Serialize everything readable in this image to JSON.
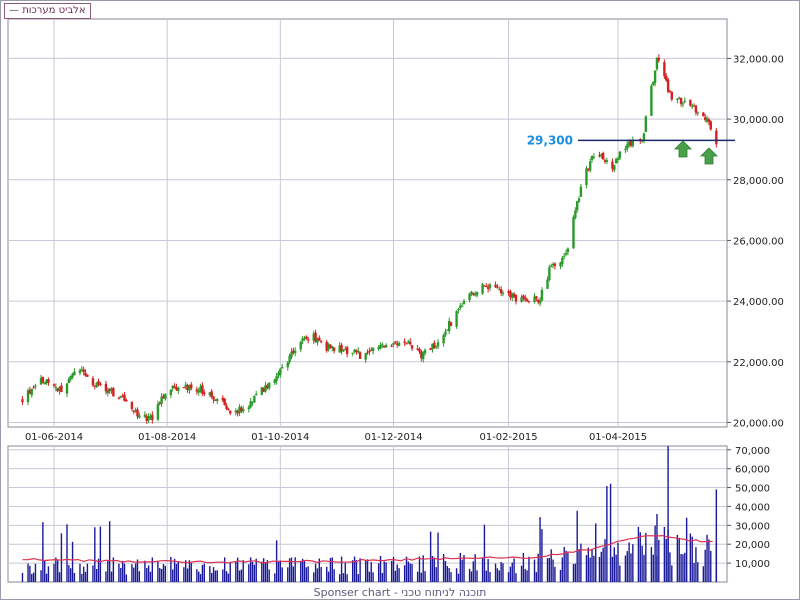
{
  "legend": {
    "dash": "—",
    "name": "אלביט מערכות"
  },
  "footer": {
    "text": "Sponser chart - תוכנה לניתוח טכני"
  },
  "colors": {
    "up": "#2a9a2a",
    "down": "#d42020",
    "volume": "#1a1a99",
    "volume_ma": "#e03050",
    "support": "#1a2a66",
    "support_label": "#1a8fe0",
    "grid": "#c8c8d8",
    "arrow": "#4aa04a",
    "watermark": "#e4e0ef"
  },
  "annotations": {
    "support_label": "29,300",
    "arrows": 2,
    "watermark_icon": "trend-arrow-circle-icon"
  },
  "chart_data": [
    {
      "type": "candlestick",
      "title": "",
      "x_ticks": [
        "01-06-2014",
        "01-08-2014",
        "01-10-2014",
        "01-12-2014",
        "01-02-2015",
        "01-04-2015"
      ],
      "y_ticks": [
        "20,000.00",
        "22,000.00",
        "24,000.00",
        "26,000.00",
        "28,000.00",
        "30,000.00",
        "32,000.00"
      ],
      "ylim": [
        19850,
        33300
      ],
      "grid": true,
      "horizontal_line": 29300,
      "close_path": [
        [
          "2014-05-15",
          20800
        ],
        [
          "2014-05-25",
          21400
        ],
        [
          "2014-06-06",
          21050
        ],
        [
          "2014-06-14",
          21900
        ],
        [
          "2014-06-22",
          21300
        ],
        [
          "2014-07-06",
          20900
        ],
        [
          "2014-07-16",
          20300
        ],
        [
          "2014-07-24",
          20100
        ],
        [
          "2014-08-01",
          21100
        ],
        [
          "2014-08-15",
          21200
        ],
        [
          "2014-08-28",
          20800
        ],
        [
          "2014-09-05",
          20300
        ],
        [
          "2014-09-14",
          20600
        ],
        [
          "2014-09-28",
          21500
        ],
        [
          "2014-10-10",
          22500
        ],
        [
          "2014-10-18",
          22900
        ],
        [
          "2014-10-25",
          22500
        ],
        [
          "2014-11-04",
          22400
        ],
        [
          "2014-11-14",
          22200
        ],
        [
          "2014-11-22",
          22400
        ],
        [
          "2014-12-06",
          22700
        ],
        [
          "2014-12-16",
          22200
        ],
        [
          "2014-12-24",
          22600
        ],
        [
          "2015-01-03",
          23500
        ],
        [
          "2015-01-10",
          24200
        ],
        [
          "2015-01-20",
          24500
        ],
        [
          "2015-02-01",
          24200
        ],
        [
          "2015-02-08",
          24000
        ],
        [
          "2015-02-18",
          24100
        ],
        [
          "2015-02-24",
          25200
        ],
        [
          "2015-03-04",
          25500
        ],
        [
          "2015-03-12",
          27800
        ],
        [
          "2015-03-20",
          29000
        ],
        [
          "2015-03-28",
          28400
        ],
        [
          "2015-04-06",
          29200
        ],
        [
          "2015-04-14",
          29300
        ],
        [
          "2015-04-22",
          32000
        ],
        [
          "2015-04-30",
          30700
        ],
        [
          "2015-05-10",
          30400
        ],
        [
          "2015-05-18",
          30100
        ],
        [
          "2015-05-24",
          29300
        ]
      ]
    },
    {
      "type": "bar",
      "title": "",
      "y_ticks": [
        "10,000",
        "20,000",
        "30,000",
        "40,000",
        "50,000",
        "60,000",
        "70,000"
      ],
      "ylim": [
        0,
        72000
      ],
      "series": [
        {
          "values": "daily volume bars"
        }
      ],
      "moving_average_path": [
        [
          "2014-05-15",
          12000
        ],
        [
          "2014-07-01",
          11000
        ],
        [
          "2014-09-01",
          10500
        ],
        [
          "2014-11-01",
          11000
        ],
        [
          "2015-01-01",
          12500
        ],
        [
          "2015-02-15",
          13000
        ],
        [
          "2015-03-15",
          17000
        ],
        [
          "2015-04-01",
          21000
        ],
        [
          "2015-04-20",
          25000
        ],
        [
          "2015-05-10",
          22000
        ],
        [
          "2015-05-24",
          21000
        ]
      ],
      "highlight_volumes": [
        [
          "2015-03-20",
          31000
        ],
        [
          "2015-03-28",
          52000
        ],
        [
          "2015-04-22",
          36000
        ],
        [
          "2015-04-28",
          72000
        ],
        [
          "2015-05-08",
          34000
        ],
        [
          "2015-05-24",
          49000
        ]
      ]
    }
  ]
}
